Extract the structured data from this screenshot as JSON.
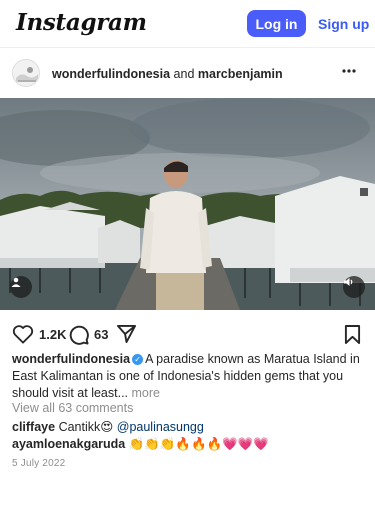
{
  "header": {
    "logo_text": "Instagram",
    "login_label": "Log in",
    "signup_label": "Sign up"
  },
  "post": {
    "author_primary": "wonderfulindonesia",
    "author_joiner": " and ",
    "author_secondary": "marcbenjamin",
    "more_icon": "more-horizontal-icon",
    "likes": "1.2K",
    "comments_count": "63",
    "caption_user": "wonderfulindonesia",
    "caption_text": "A paradise known as Maratua Island in East Kalimantan is one of Indonesia's hidden gems that you should visit at least...",
    "caption_more": " more",
    "view_all_comments": "View all 63 comments",
    "comments": [
      {
        "user": "cliffaye",
        "text": "Cantikk😍 ",
        "mention": "@paulinasungg"
      },
      {
        "user": "ayamloenakgaruda",
        "text": "👏👏👏🔥🔥🔥💗💗💗"
      }
    ],
    "date": "5 July 2022"
  },
  "colors": {
    "accent": "#4a5df9",
    "link": "#3b5bf6",
    "muted": "#8e8e8e",
    "verified": "#3897f0"
  }
}
